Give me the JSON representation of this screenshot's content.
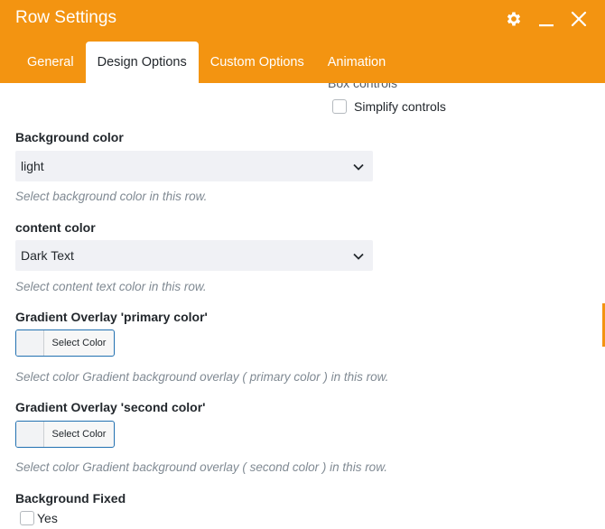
{
  "window": {
    "title": "Row Settings"
  },
  "header_icons": [
    "gear-icon",
    "minimize-icon",
    "close-icon"
  ],
  "tabs": [
    {
      "label": "General",
      "active": false
    },
    {
      "label": "Design Options",
      "active": true
    },
    {
      "label": "Custom Options",
      "active": false
    },
    {
      "label": "Animation",
      "active": false
    }
  ],
  "box_controls": {
    "cutoff_label": "Box controls",
    "simplify_label": "Simplify controls",
    "simplify_checked": false
  },
  "background_color": {
    "label": "Background color",
    "value": "light",
    "help": "Select background color in this row."
  },
  "content_color": {
    "label": "content color",
    "value": "Dark Text",
    "help": "Select content text color in this row."
  },
  "gradient_primary": {
    "label": "Gradient Overlay 'primary color'",
    "button_label": "Select Color",
    "help": "Select color Gradient background overlay ( primary color ) in this row."
  },
  "gradient_second": {
    "label": "Gradient Overlay 'second color'",
    "button_label": "Select Color",
    "help": "Select color Gradient background overlay ( second color ) in this row."
  },
  "background_fixed": {
    "label": "Background Fixed",
    "option_label": "Yes",
    "checked": false
  },
  "colors": {
    "accent": "#f39411",
    "header_text": "#ffffff",
    "select_bg": "#f0f1f5",
    "help_text": "#808a93",
    "button_border": "#2271b1"
  }
}
